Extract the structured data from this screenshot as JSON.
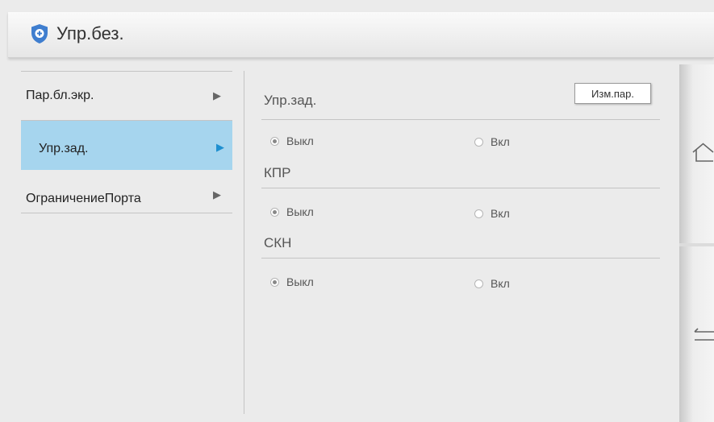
{
  "header": {
    "title": "Упр.без.",
    "icon": "shield-plus-icon",
    "icon_color": "#3f7ecf"
  },
  "menu": {
    "items": [
      {
        "label": "Пар.бл.экр.",
        "active": false
      },
      {
        "label": "Упр.зад.",
        "active": true
      },
      {
        "label": "ОграничениеПорта",
        "active": false
      }
    ]
  },
  "main": {
    "section_title": "Упр.зад.",
    "edit_button": "Изм.пар.",
    "groups": [
      {
        "options": {
          "off": "Выкл",
          "on": "Вкл"
        },
        "selected": "off"
      },
      {
        "title": "КПР",
        "options": {
          "off": "Выкл",
          "on": "Вкл"
        },
        "selected": "off"
      },
      {
        "title": "СКН",
        "options": {
          "off": "Выкл",
          "on": "Вкл"
        },
        "selected": "off"
      }
    ]
  },
  "sidebar_right": {
    "home_icon": "home-icon",
    "back_icon": "back-icon"
  },
  "colors": {
    "active_menu_bg": "#a6d5ee",
    "active_arrow": "#1e8fd0"
  }
}
